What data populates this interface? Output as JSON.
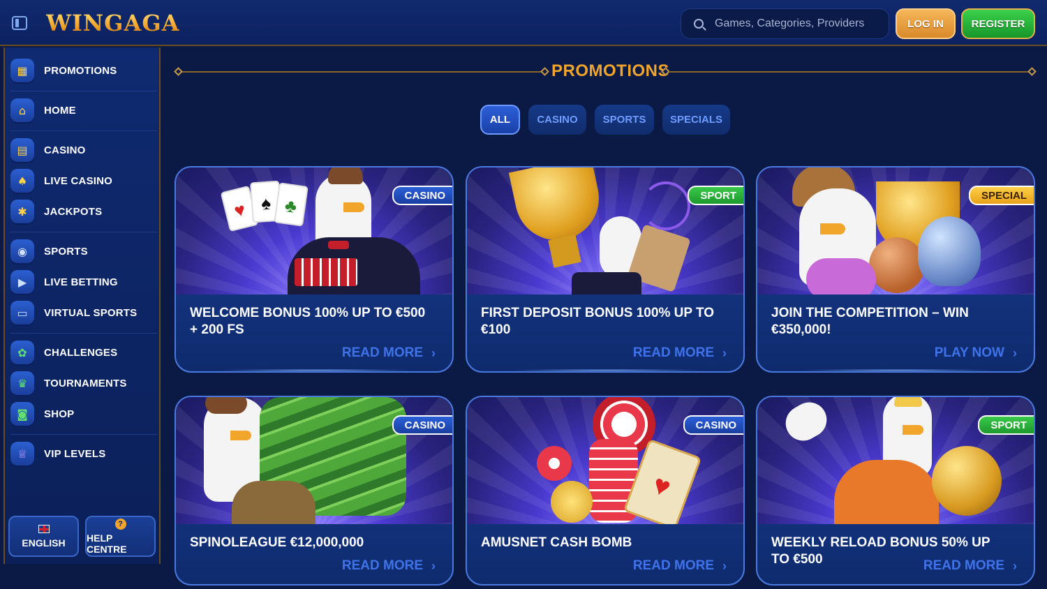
{
  "header": {
    "logo_text": "WINGAGA",
    "search_placeholder": "Games, Categories, Providers",
    "login_label": "LOG IN",
    "register_label": "REGISTER"
  },
  "sidebar": {
    "items": [
      {
        "label": "PROMOTIONS",
        "icon": "gift-icon"
      },
      {
        "label": "HOME",
        "icon": "home-icon"
      },
      {
        "label": "CASINO",
        "icon": "slot-machine-icon"
      },
      {
        "label": "LIVE CASINO",
        "icon": "cards-icon"
      },
      {
        "label": "JACKPOTS",
        "icon": "star-icon"
      },
      {
        "label": "SPORTS",
        "icon": "soccer-ball-icon"
      },
      {
        "label": "LIVE BETTING",
        "icon": "play-icon"
      },
      {
        "label": "VIRTUAL SPORTS",
        "icon": "gamepad-icon"
      },
      {
        "label": "CHALLENGES",
        "icon": "medal-icon"
      },
      {
        "label": "TOURNAMENTS",
        "icon": "trophy-icon"
      },
      {
        "label": "SHOP",
        "icon": "shopping-bag-icon"
      },
      {
        "label": "VIP LEVELS",
        "icon": "crown-icon"
      }
    ],
    "language_label": "ENGLISH",
    "help_label": "HELP CENTRE"
  },
  "main": {
    "title": "PROMOTIONS",
    "tabs": [
      {
        "label": "ALL",
        "active": true
      },
      {
        "label": "CASINO",
        "active": false
      },
      {
        "label": "SPORTS",
        "active": false
      },
      {
        "label": "SPECIALS",
        "active": false
      }
    ],
    "cards": [
      {
        "badge": "CASINO",
        "title": "WELCOME BONUS 100% UP TO €500 + 200 FS",
        "action": "READ MORE"
      },
      {
        "badge": "SPORT",
        "title": "FIRST DEPOSIT BONUS 100% UP TO €100",
        "action": "READ MORE"
      },
      {
        "badge": "SPECIAL",
        "title": "JOIN THE COMPETITION – WIN €350,000!",
        "action": "PLAY NOW"
      },
      {
        "badge": "CASINO",
        "title": "SPINOLEAGUE €12,000,000",
        "action": "READ MORE"
      },
      {
        "badge": "CASINO",
        "title": "AMUSNET CASH BOMB",
        "action": "READ MORE"
      },
      {
        "badge": "SPORT",
        "title": "WEEKLY RELOAD BONUS 50% UP TO €500",
        "action": "READ MORE"
      }
    ]
  },
  "colors": {
    "background": "#0a1a45",
    "accent_gold": "#f2a52b",
    "card_border": "#4a79e0",
    "link_blue": "#3f73ea",
    "register_green": "#2bb83c"
  }
}
